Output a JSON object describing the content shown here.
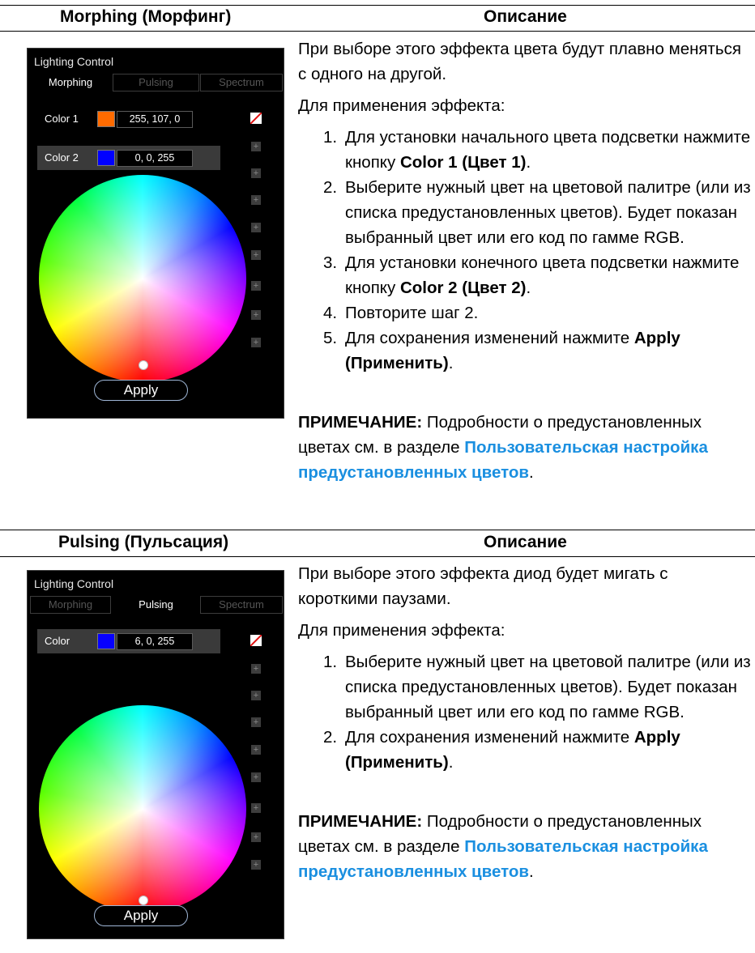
{
  "sections": [
    {
      "header_left": "Morphing (Морфинг)",
      "header_right": "Описание",
      "panel": {
        "title": "Lighting Control",
        "tabs": [
          "Morphing",
          "Pulsing",
          "Spectrum"
        ],
        "active_tab": "Morphing",
        "colors": [
          {
            "label": "Color 1",
            "value": "255, 107, 0",
            "swatch": "#ff6b00"
          },
          {
            "label": "Color 2",
            "value": "0, 0, 255",
            "swatch": "#0000ff"
          }
        ],
        "apply_label": "Apply"
      },
      "intro": "При выборе этого эффекта цвета будут плавно меняться с одного на другой.",
      "steps_intro": "Для применения эффекта:",
      "steps": [
        {
          "num": "1.",
          "text": "Для установки начального цвета подсветки нажмите кнопку ",
          "bold": "Color 1 (Цвет 1)",
          "tail": "."
        },
        {
          "num": "2.",
          "text": "Выберите нужный цвет на цветовой палитре (или из списка предустановленных цветов). Будет показан выбранный цвет или его код по гамме RGB.",
          "bold": "",
          "tail": ""
        },
        {
          "num": "3.",
          "text": "Для установки конечного цвета подсветки нажмите кнопку ",
          "bold": "Color 2 (Цвет 2)",
          "tail": "."
        },
        {
          "num": "4.",
          "text": "Повторите шаг 2.",
          "bold": "",
          "tail": ""
        },
        {
          "num": "5.",
          "text": "Для сохранения изменений нажмите ",
          "bold": "Apply (Применить)",
          "tail": "."
        }
      ],
      "note_label": "ПРИМЕЧАНИЕ:",
      "note_text": " Подробности о предустановленных цветах см. в разделе ",
      "note_link": "Пользовательская настройка предустановленных цветов",
      "note_tail": "."
    },
    {
      "header_left": "Pulsing (Пульсация)",
      "header_right": "Описание",
      "panel": {
        "title": "Lighting Control",
        "tabs": [
          "Morphing",
          "Pulsing",
          "Spectrum"
        ],
        "active_tab": "Pulsing",
        "colors": [
          {
            "label": "Color",
            "value": "6, 0, 255",
            "swatch": "#0600ff"
          }
        ],
        "apply_label": "Apply"
      },
      "intro": "При выборе этого эффекта диод будет мигать с короткими паузами.",
      "steps_intro": "Для применения эффекта:",
      "steps": [
        {
          "num": "1.",
          "text": "Выберите нужный цвет на цветовой палитре (или из списка предустановленных цветов). Будет показан выбранный цвет или его код по гамме RGB.",
          "bold": "",
          "tail": ""
        },
        {
          "num": "2.",
          "text": "Для сохранения изменений нажмите ",
          "bold": "Apply (Применить)",
          "tail": "."
        }
      ],
      "note_label": "ПРИМЕЧАНИЕ:",
      "note_text": " Подробности о предустановленных цветах см. в разделе ",
      "note_link": "Пользовательская настройка предустановленных цветов",
      "note_tail": "."
    }
  ]
}
